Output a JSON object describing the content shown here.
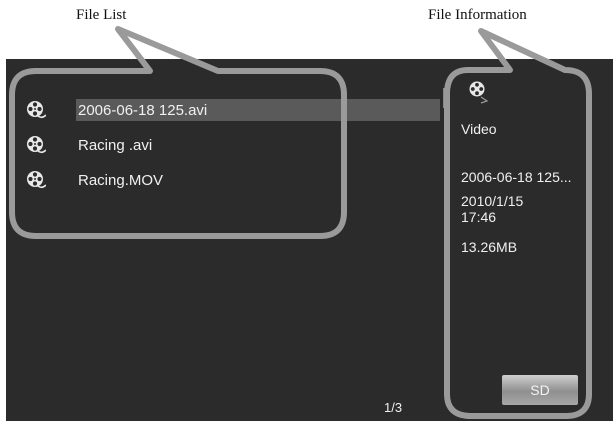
{
  "callouts": {
    "file_list": "File List",
    "file_information": "File Information"
  },
  "files": [
    {
      "name": "2006-06-18 125.avi",
      "selected": true,
      "icon": "film-reel-icon"
    },
    {
      "name": "Racing .avi",
      "selected": false,
      "icon": "film-reel-icon"
    },
    {
      "name": "Racing.MOV",
      "selected": false,
      "icon": "film-reel-icon"
    }
  ],
  "info": {
    "icon": "film-reel-icon",
    "type": "Video",
    "filename": "2006-06-18 125...",
    "date": "2010/1/15",
    "time": "17:46",
    "size": "13.26MB"
  },
  "pager": {
    "page": "1/3"
  },
  "storage_button": {
    "label": "SD"
  },
  "colors": {
    "screen_bg": "#2b2b2b",
    "callout_outline": "#9a9a9a",
    "selection": "#5a5a5a"
  }
}
